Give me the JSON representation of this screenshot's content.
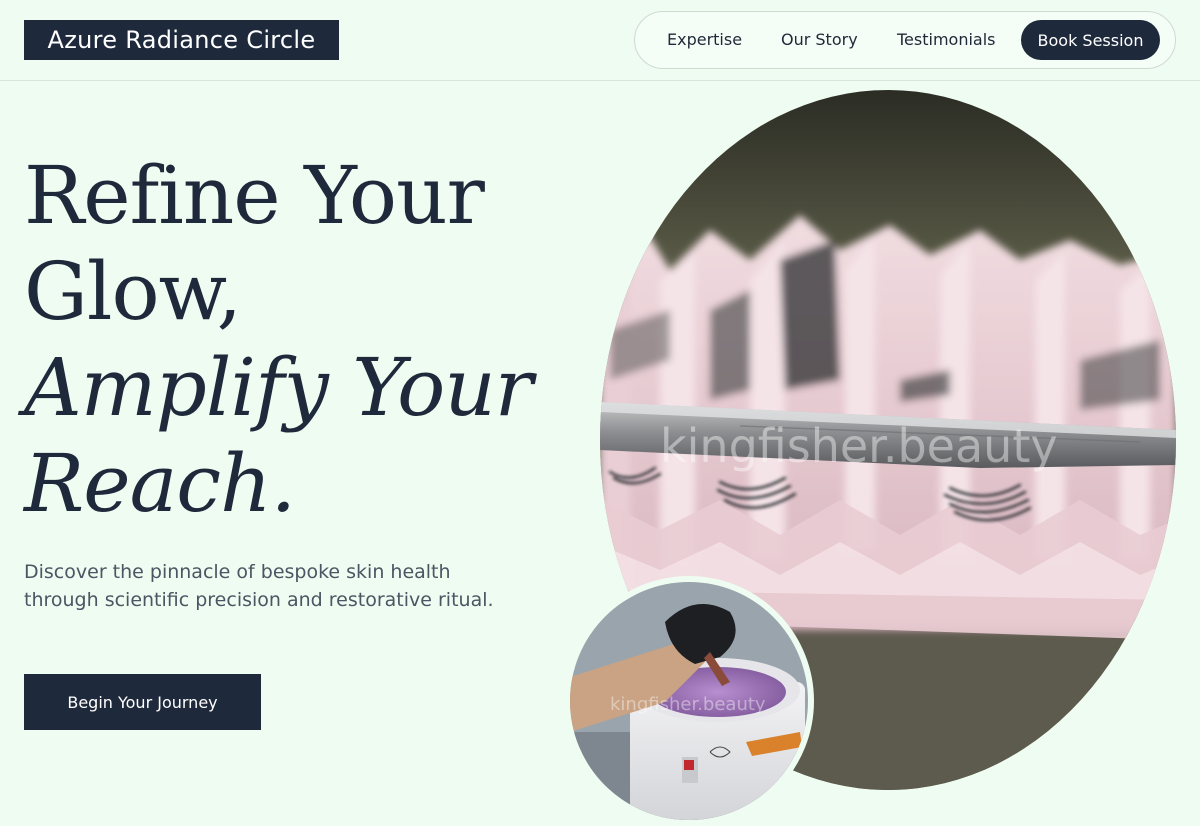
{
  "brand": {
    "name": "Azure Radiance Circle"
  },
  "nav": {
    "links": [
      "Expertise",
      "Our Story",
      "Testimonials"
    ],
    "cta": "Book Session"
  },
  "hero": {
    "headline_line1": "Refine Your",
    "headline_line2": "Glow,",
    "headline_line3": "Amplify Your",
    "headline_line4": "Reach.",
    "subtitle": "Discover the pinnacle of bespoke skin health through scientific precision and restorative ritual.",
    "cta": "Begin Your Journey"
  },
  "images": {
    "main_alt": "Eyelash extension trays with tweezers",
    "main_watermark": "kingfisher.beauty",
    "secondary_alt": "Gloved hand dipping spatula into wax warmer",
    "secondary_watermark": "kingfisher.beauty"
  },
  "colors": {
    "background": "#effcf1",
    "primary": "#1e293b",
    "text_muted": "#4b5563",
    "tray_pink": "#e8c9cf"
  }
}
